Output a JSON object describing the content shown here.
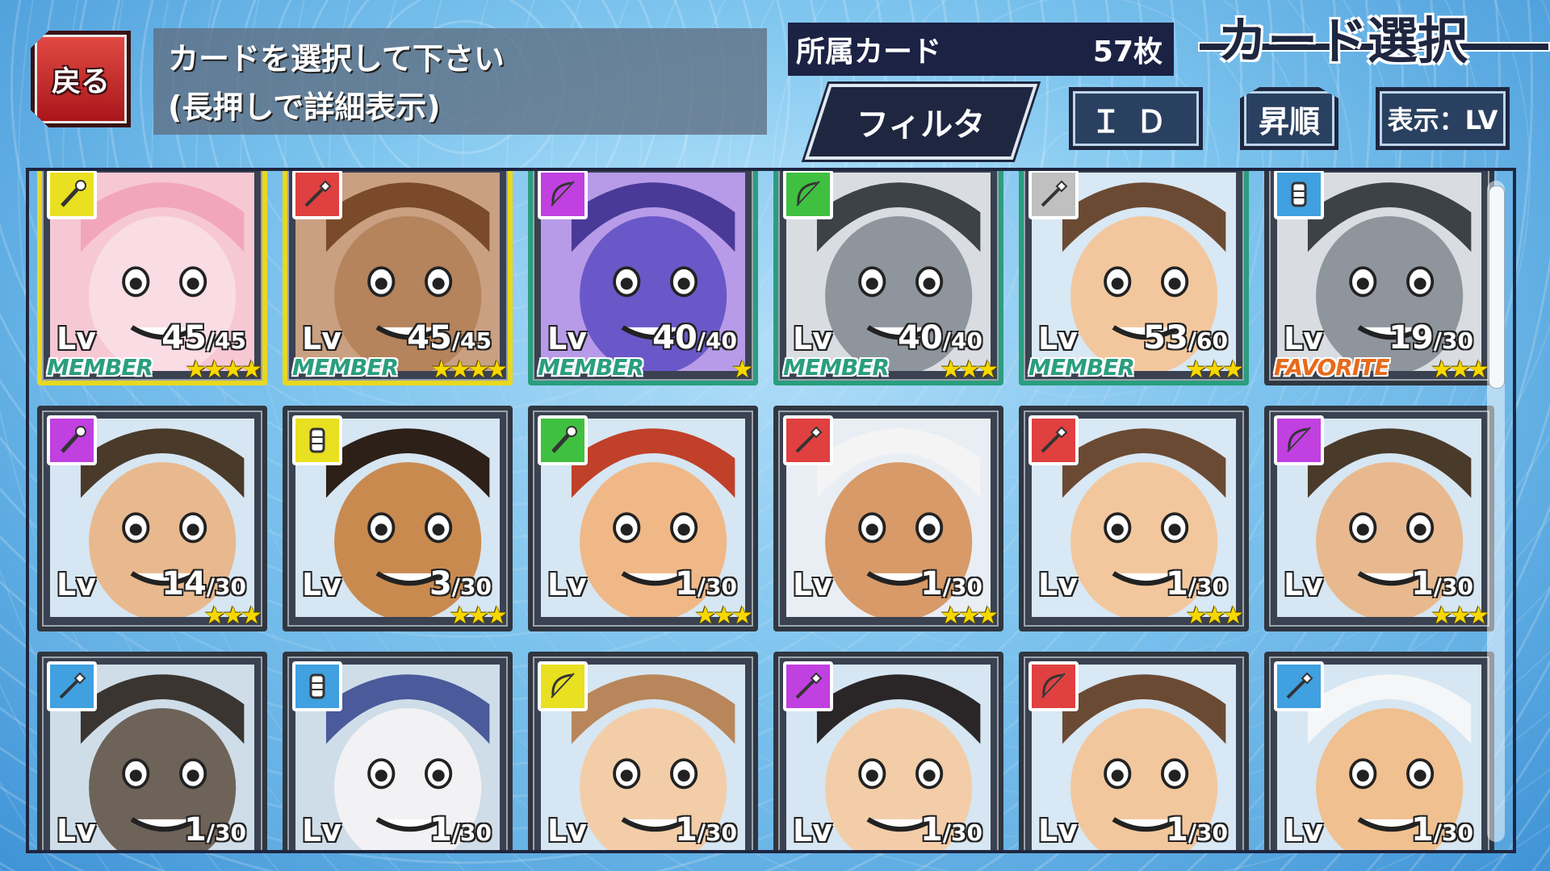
{
  "header": {
    "back_label": "戻る",
    "instruction_line1": "カードを選択して下さい",
    "instruction_line2": "(長押しで詳細表示)",
    "count_label": "所属カード",
    "count_value": "57枚",
    "title": "カード選択",
    "filter_label": "フィルタ",
    "sort_key_label": "ＩＤ",
    "order_label": "昇順",
    "view_label": "表示：LV"
  },
  "colors": {
    "accent_dark": "#1e2640",
    "back_red": "#c22028",
    "member_green": "#2a9e7e",
    "favorite_orange": "#e86a1a",
    "star_yellow": "#f6d800"
  },
  "cards": [
    {
      "lv_label": "Lv",
      "lv": "45",
      "max": "/45",
      "tag": "MEMBER",
      "stars": "★★★★",
      "weapon": "staff-icon",
      "weapon_color": "#e8e020",
      "art": "pink-beast",
      "frame": "gold"
    },
    {
      "lv_label": "Lv",
      "lv": "45",
      "max": "/45",
      "tag": "MEMBER",
      "stars": "★★★★",
      "weapon": "spear-icon",
      "weapon_color": "#e04040",
      "art": "brown-beast",
      "frame": "gold"
    },
    {
      "lv_label": "Lv",
      "lv": "40",
      "max": "/40",
      "tag": "MEMBER",
      "stars": "★",
      "weapon": "bow-icon",
      "weapon_color": "#c040e0",
      "art": "purple-monster",
      "frame": "green"
    },
    {
      "lv_label": "Lv",
      "lv": "40",
      "max": "/40",
      "tag": "MEMBER",
      "stars": "★★★",
      "weapon": "bow-icon",
      "weapon_color": "#40c040",
      "art": "gray-beast",
      "frame": "green"
    },
    {
      "lv_label": "Lv",
      "lv": "53",
      "max": "/60",
      "tag": "MEMBER",
      "stars": "★★★",
      "weapon": "spear-icon",
      "weapon_color": "#c0c0c0",
      "art": "human-brown",
      "frame": "green"
    },
    {
      "lv_label": "Lv",
      "lv": "19",
      "max": "/30",
      "tag": "FAVORITE",
      "stars": "★★★",
      "weapon": "gauntlet-icon",
      "weapon_color": "#40a0e0",
      "art": "gray-beast",
      "frame": "normal"
    },
    {
      "lv_label": "Lv",
      "lv": "14",
      "max": "/30",
      "tag": "",
      "stars": "★★★",
      "weapon": "staff-icon",
      "weapon_color": "#c040e0",
      "art": "human-glasses",
      "frame": "normal"
    },
    {
      "lv_label": "Lv",
      "lv": "3",
      "max": "/30",
      "tag": "",
      "stars": "★★★",
      "weapon": "gauntlet-icon",
      "weapon_color": "#e8e020",
      "art": "human-tan",
      "frame": "normal"
    },
    {
      "lv_label": "Lv",
      "lv": "1",
      "max": "/30",
      "tag": "",
      "stars": "★★★",
      "weapon": "staff-icon",
      "weapon_color": "#40c040",
      "art": "human-red",
      "frame": "normal"
    },
    {
      "lv_label": "Lv",
      "lv": "1",
      "max": "/30",
      "tag": "",
      "stars": "★★★",
      "weapon": "spear-icon",
      "weapon_color": "#e04040",
      "art": "human-hood",
      "frame": "normal"
    },
    {
      "lv_label": "Lv",
      "lv": "1",
      "max": "/30",
      "tag": "",
      "stars": "★★★",
      "weapon": "spear-icon",
      "weapon_color": "#e04040",
      "art": "human-brown",
      "frame": "normal"
    },
    {
      "lv_label": "Lv",
      "lv": "1",
      "max": "/30",
      "tag": "",
      "stars": "★★★",
      "weapon": "bow-icon",
      "weapon_color": "#c040e0",
      "art": "human-glasses",
      "frame": "normal"
    },
    {
      "lv_label": "Lv",
      "lv": "1",
      "max": "/30",
      "tag": "",
      "stars": "★★★",
      "weapon": "spear-icon",
      "weapon_color": "#40a0e0",
      "art": "dark-beast",
      "frame": "normal"
    },
    {
      "lv_label": "Lv",
      "lv": "1",
      "max": "/30",
      "tag": "",
      "stars": "★★★",
      "weapon": "gauntlet-icon",
      "weapon_color": "#40a0e0",
      "art": "wolf-blue",
      "frame": "normal"
    },
    {
      "lv_label": "Lv",
      "lv": "1",
      "max": "/30",
      "tag": "",
      "stars": "★★★",
      "weapon": "bow-icon",
      "weapon_color": "#e8e020",
      "art": "human-light",
      "frame": "normal"
    },
    {
      "lv_label": "Lv",
      "lv": "1",
      "max": "/30",
      "tag": "",
      "stars": "★★★",
      "weapon": "spear-icon",
      "weapon_color": "#c040e0",
      "art": "human-dark",
      "frame": "normal"
    },
    {
      "lv_label": "Lv",
      "lv": "1",
      "max": "/30",
      "tag": "",
      "stars": "★★★",
      "weapon": "bow-icon",
      "weapon_color": "#e04040",
      "art": "human-brown",
      "frame": "normal"
    },
    {
      "lv_label": "Lv",
      "lv": "1",
      "max": "/30",
      "tag": "",
      "stars": "★★★",
      "weapon": "spear-icon",
      "weapon_color": "#40a0e0",
      "art": "human-band",
      "frame": "normal"
    }
  ]
}
